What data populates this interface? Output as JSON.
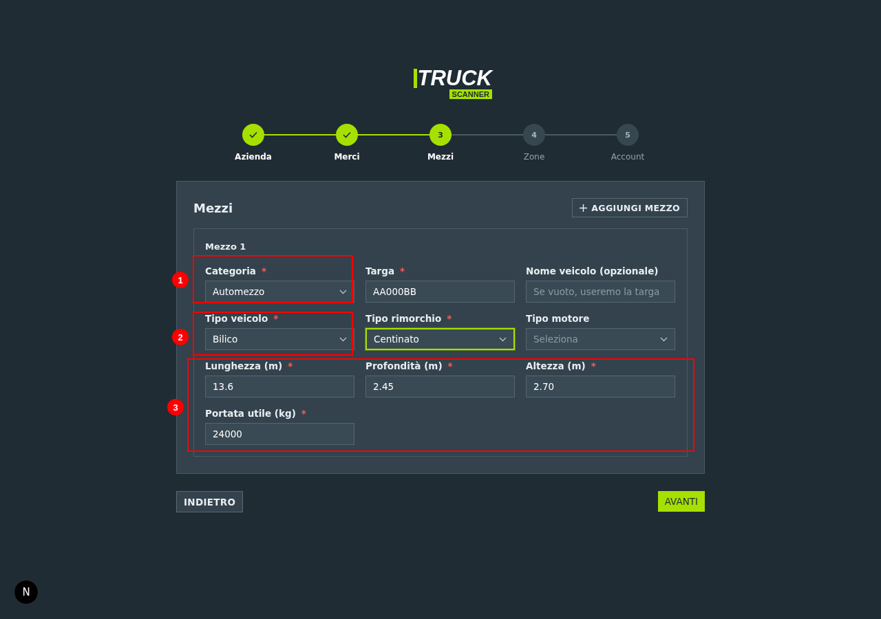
{
  "logo": {
    "title": "TRUCK",
    "subtitle": "SCANNER"
  },
  "steps": [
    {
      "kind": "done",
      "label": "Azienda"
    },
    {
      "kind": "done",
      "label": "Merci"
    },
    {
      "kind": "current",
      "marker": "3",
      "label": "Mezzi"
    },
    {
      "kind": "todo",
      "marker": "4",
      "label": "Zone"
    },
    {
      "kind": "todo",
      "marker": "5",
      "label": "Account"
    }
  ],
  "card": {
    "title": "Mezzi",
    "add_button": "AGGIUNGI MEZZO",
    "vehicle": {
      "title": "Mezzo 1",
      "fields": [
        {
          "label": "Categoria",
          "required_mark": "*",
          "kind": "select",
          "value": "Automezzo",
          "focused": false
        },
        {
          "label": "Targa",
          "required_mark": "*",
          "kind": "input",
          "value": "AA000BB",
          "focused": false
        },
        {
          "label": "Nome veicolo (opzionale)",
          "kind": "input",
          "placeholder": "Se vuoto, useremo la targa",
          "focused": false
        },
        {
          "label": "Tipo veicolo",
          "required_mark": "*",
          "kind": "select",
          "value": "Bilico",
          "focused": false
        },
        {
          "label": "Tipo rimorchio",
          "required_mark": "*",
          "kind": "select",
          "value": "Centinato",
          "focused": true
        },
        {
          "label": "Tipo motore",
          "kind": "select",
          "placeholder": "Seleziona",
          "focused": false
        },
        {
          "label": "Lunghezza (m)",
          "required_mark": "*",
          "kind": "input",
          "value": "13.6",
          "focused": false
        },
        {
          "label": "Profondità (m)",
          "required_mark": "*",
          "kind": "input",
          "value": "2.45",
          "focused": false
        },
        {
          "label": "Altezza (m)",
          "required_mark": "*",
          "kind": "input",
          "value": "2.70",
          "focused": false
        },
        {
          "label": "Portata utile (kg)",
          "required_mark": "*",
          "kind": "input",
          "value": "24000",
          "focused": false
        }
      ]
    }
  },
  "back_button": "INDIETRO",
  "next_button": "AVANTI",
  "dev_badge": "N",
  "annotations": [
    {
      "number": "1"
    },
    {
      "number": "2"
    },
    {
      "number": "3"
    }
  ]
}
